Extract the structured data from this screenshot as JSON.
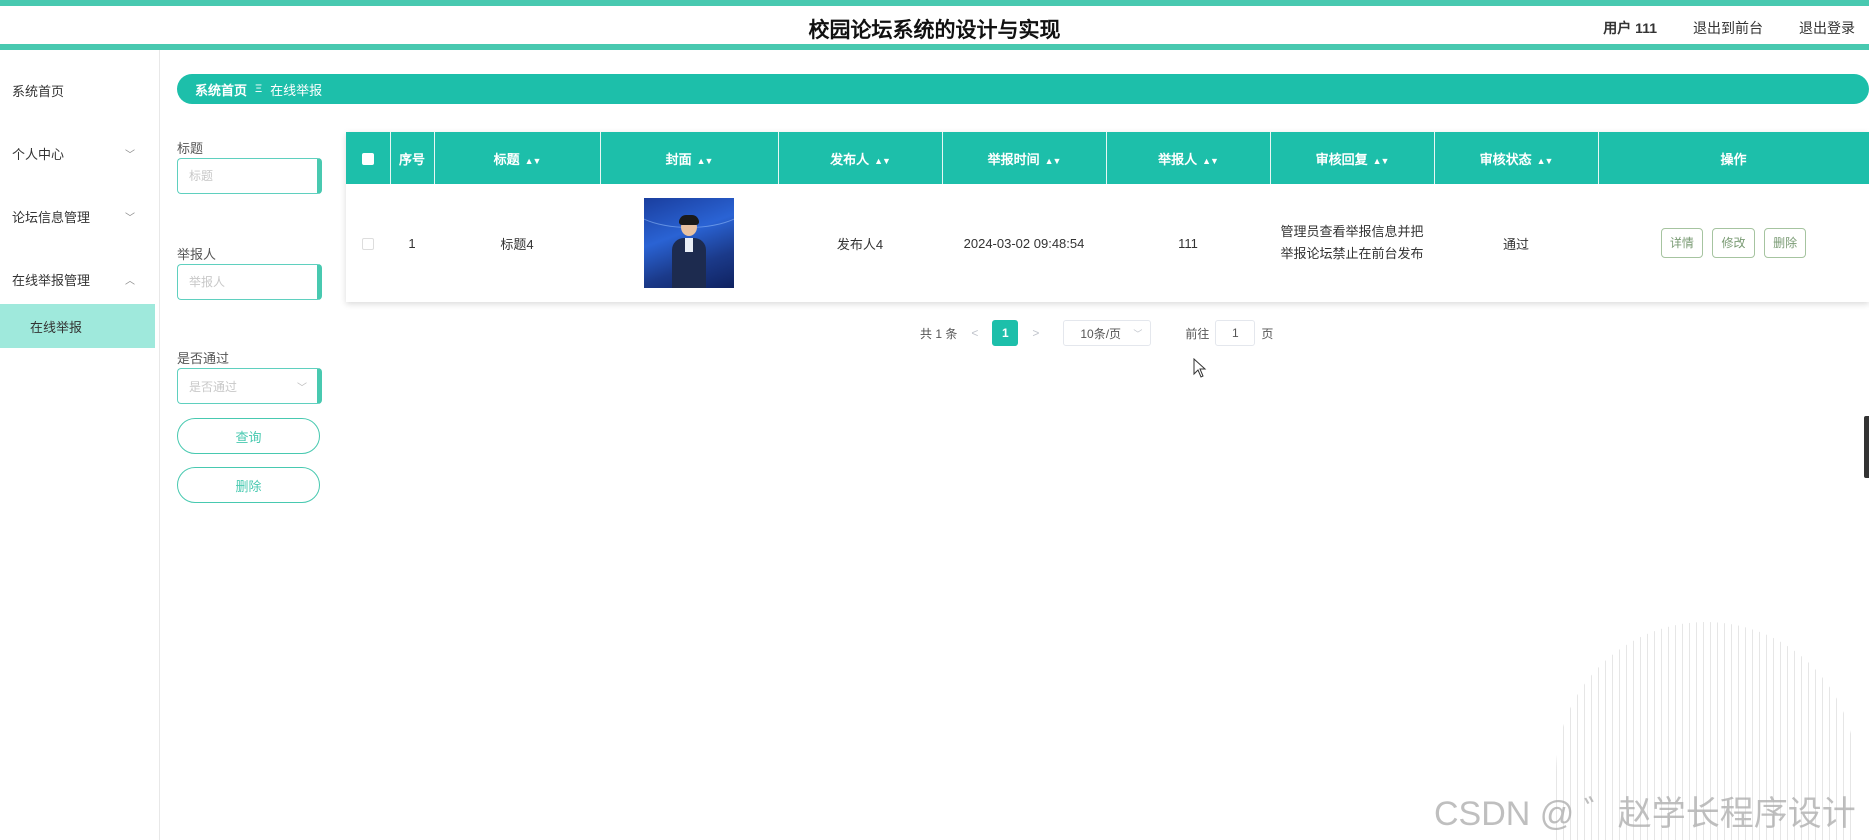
{
  "header": {
    "title": "校园论坛系统的设计与实现",
    "user": "用户 111",
    "back_to_front": "退出到前台",
    "logout": "退出登录"
  },
  "sidebar": {
    "items": [
      {
        "label": "系统首页"
      },
      {
        "label": "个人中心"
      },
      {
        "label": "论坛信息管理"
      },
      {
        "label": "在线举报管理"
      }
    ],
    "sub_item": "在线举报"
  },
  "breadcrumb": {
    "home": "系统首页",
    "separator": "Ξ",
    "current": "在线举报"
  },
  "filters": {
    "title_label": "标题",
    "title_placeholder": "标题",
    "reporter_label": "举报人",
    "reporter_placeholder": "举报人",
    "passed_label": "是否通过",
    "passed_placeholder": "是否通过",
    "query_button": "查询",
    "delete_button": "删除"
  },
  "table": {
    "columns": [
      "序号",
      "标题",
      "封面",
      "发布人",
      "举报时间",
      "举报人",
      "审核回复",
      "审核状态",
      "操作"
    ],
    "rows": [
      {
        "index": "1",
        "title": "标题4",
        "publisher": "发布人4",
        "report_time": "2024-03-02 09:48:54",
        "reporter": "111",
        "reply_line1": "管理员查看举报信息并把",
        "reply_line2": "举报论坛禁止在前台发布",
        "status": "通过",
        "actions": {
          "detail": "详情",
          "edit": "修改",
          "delete": "删除"
        }
      }
    ]
  },
  "pagination": {
    "total": "共 1 条",
    "prev": "<",
    "current_page": "1",
    "next": ">",
    "page_size": "10条/页",
    "goto_label": "前往",
    "goto_value": "1",
    "page_suffix": "页"
  },
  "watermark": "CSDN @ ゛赵学长程序设计",
  "colors": {
    "accent": "#1dbfaa",
    "accent_light": "#9fe9dc",
    "action_border": "#a6c4a0"
  }
}
